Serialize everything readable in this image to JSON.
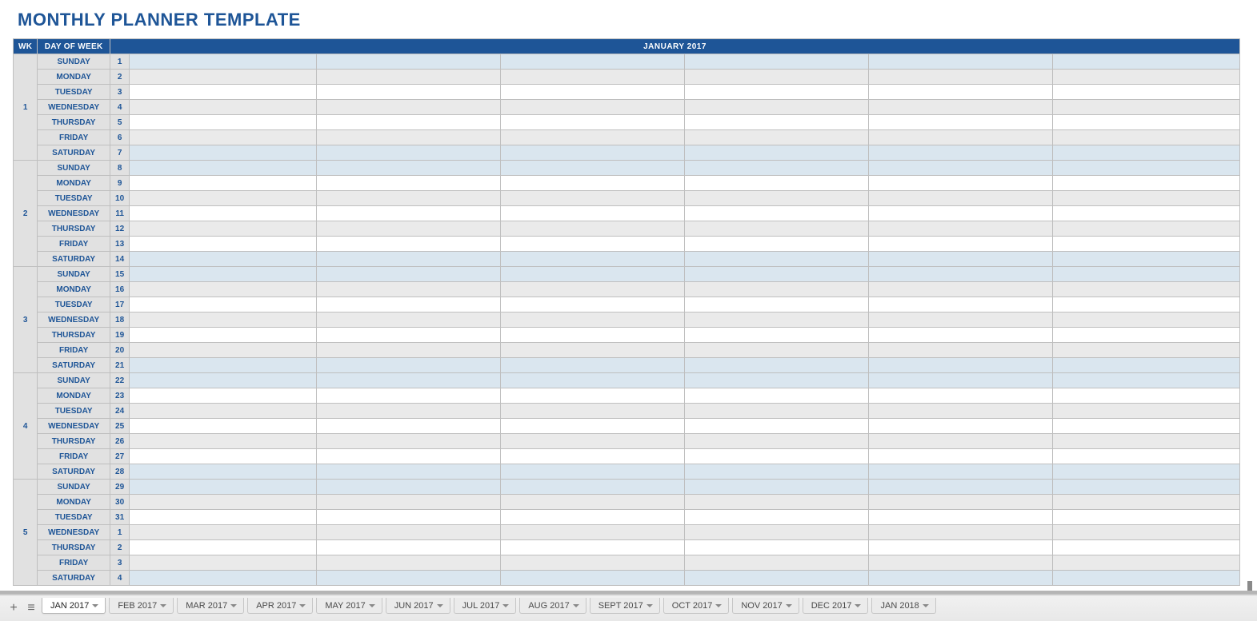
{
  "title": "MONTHLY PLANNER TEMPLATE",
  "headers": {
    "wk": "WK",
    "dow": "DAY OF WEEK",
    "month": "JANUARY 2017"
  },
  "weeks": [
    {
      "num": "1",
      "days": [
        {
          "dow": "SUNDAY",
          "dn": "1",
          "shade": "blue"
        },
        {
          "dow": "MONDAY",
          "dn": "2",
          "shade": "gray"
        },
        {
          "dow": "TUESDAY",
          "dn": "3",
          "shade": "white"
        },
        {
          "dow": "WEDNESDAY",
          "dn": "4",
          "shade": "gray"
        },
        {
          "dow": "THURSDAY",
          "dn": "5",
          "shade": "white"
        },
        {
          "dow": "FRIDAY",
          "dn": "6",
          "shade": "gray"
        },
        {
          "dow": "SATURDAY",
          "dn": "7",
          "shade": "blue"
        }
      ]
    },
    {
      "num": "2",
      "days": [
        {
          "dow": "SUNDAY",
          "dn": "8",
          "shade": "blue"
        },
        {
          "dow": "MONDAY",
          "dn": "9",
          "shade": "white"
        },
        {
          "dow": "TUESDAY",
          "dn": "10",
          "shade": "gray"
        },
        {
          "dow": "WEDNESDAY",
          "dn": "11",
          "shade": "white"
        },
        {
          "dow": "THURSDAY",
          "dn": "12",
          "shade": "gray"
        },
        {
          "dow": "FRIDAY",
          "dn": "13",
          "shade": "white"
        },
        {
          "dow": "SATURDAY",
          "dn": "14",
          "shade": "blue"
        }
      ]
    },
    {
      "num": "3",
      "days": [
        {
          "dow": "SUNDAY",
          "dn": "15",
          "shade": "blue"
        },
        {
          "dow": "MONDAY",
          "dn": "16",
          "shade": "gray"
        },
        {
          "dow": "TUESDAY",
          "dn": "17",
          "shade": "white"
        },
        {
          "dow": "WEDNESDAY",
          "dn": "18",
          "shade": "gray"
        },
        {
          "dow": "THURSDAY",
          "dn": "19",
          "shade": "white"
        },
        {
          "dow": "FRIDAY",
          "dn": "20",
          "shade": "gray"
        },
        {
          "dow": "SATURDAY",
          "dn": "21",
          "shade": "blue"
        }
      ]
    },
    {
      "num": "4",
      "days": [
        {
          "dow": "SUNDAY",
          "dn": "22",
          "shade": "blue"
        },
        {
          "dow": "MONDAY",
          "dn": "23",
          "shade": "white"
        },
        {
          "dow": "TUESDAY",
          "dn": "24",
          "shade": "gray"
        },
        {
          "dow": "WEDNESDAY",
          "dn": "25",
          "shade": "white"
        },
        {
          "dow": "THURSDAY",
          "dn": "26",
          "shade": "gray"
        },
        {
          "dow": "FRIDAY",
          "dn": "27",
          "shade": "white"
        },
        {
          "dow": "SATURDAY",
          "dn": "28",
          "shade": "blue"
        }
      ]
    },
    {
      "num": "5",
      "days": [
        {
          "dow": "SUNDAY",
          "dn": "29",
          "shade": "blue"
        },
        {
          "dow": "MONDAY",
          "dn": "30",
          "shade": "gray"
        },
        {
          "dow": "TUESDAY",
          "dn": "31",
          "shade": "white"
        },
        {
          "dow": "WEDNESDAY",
          "dn": "1",
          "shade": "gray"
        },
        {
          "dow": "THURSDAY",
          "dn": "2",
          "shade": "white"
        },
        {
          "dow": "FRIDAY",
          "dn": "3",
          "shade": "gray"
        },
        {
          "dow": "SATURDAY",
          "dn": "4",
          "shade": "blue"
        }
      ]
    }
  ],
  "tabs": [
    {
      "label": "JAN 2017",
      "active": true
    },
    {
      "label": "FEB 2017",
      "active": false
    },
    {
      "label": "MAR 2017",
      "active": false
    },
    {
      "label": "APR 2017",
      "active": false
    },
    {
      "label": "MAY 2017",
      "active": false
    },
    {
      "label": "JUN 2017",
      "active": false
    },
    {
      "label": "JUL 2017",
      "active": false
    },
    {
      "label": "AUG 2017",
      "active": false
    },
    {
      "label": "SEPT 2017",
      "active": false
    },
    {
      "label": "OCT 2017",
      "active": false
    },
    {
      "label": "NOV 2017",
      "active": false
    },
    {
      "label": "DEC 2017",
      "active": false
    },
    {
      "label": "JAN 2018",
      "active": false
    }
  ]
}
